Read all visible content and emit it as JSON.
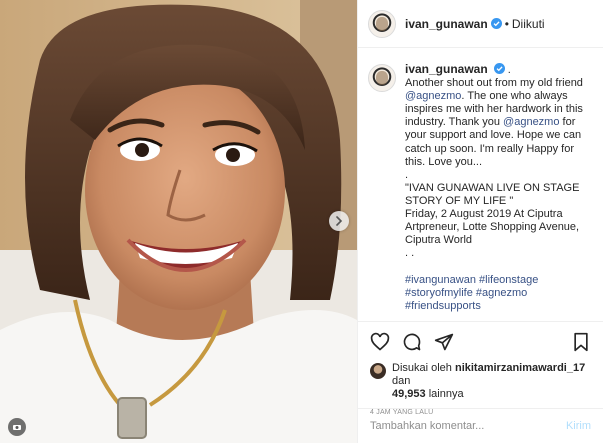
{
  "header": {
    "username": "ivan_gunawan",
    "separator": "•",
    "follow_status": "Diikuti"
  },
  "caption": {
    "username": "ivan_gunawan",
    "lines": [
      {
        "t": "Another shout out from my old friend"
      },
      {
        "t": "@agnezmo",
        "mention": true,
        "rest": ". The one who always"
      },
      {
        "t": "inspires me with her hardwork in this"
      },
      {
        "t": "industry. Thank you ",
        "mention2": "@agnezmo",
        "rest": " for"
      },
      {
        "t": "your support and love. Hope we can"
      },
      {
        "t": "catch up soon. I'm really Happy for"
      },
      {
        "t": "this. Love you..."
      }
    ],
    "dot1": ".",
    "event_title_1": "\"IVAN GUNAWAN LIVE ON STAGE",
    "event_title_2": "STORY OF MY LIFE \"",
    "event_date_1": "Friday, 2 August 2019 At Ciputra",
    "event_date_2": "Artpreneur, Lotte Shopping Avenue,",
    "event_date_3": "Ciputra World",
    "dots": ". .",
    "hashtags_1": "#ivangunawan #lifeonstage",
    "hashtags_2": "#storyofmylife #agnezmo",
    "hashtags_3": "#friendsupports"
  },
  "actions": {
    "like_icon": "heart-icon",
    "comment_icon": "comment-icon",
    "share_icon": "share-icon",
    "save_icon": "bookmark-icon"
  },
  "likes": {
    "prefix": "Disukai oleh ",
    "user": "nikitamirzanimawardi_17",
    "and": " dan",
    "count": "49,953",
    "suffix": " lainnya"
  },
  "timestamp": "4 JAM YANG LALU",
  "comment": {
    "placeholder": "Tambahkan komentar...",
    "post_label": "Kirim"
  },
  "colors": {
    "verified": "#3897f0",
    "link": "#385185",
    "post_button_disabled": "#b2dffc"
  }
}
